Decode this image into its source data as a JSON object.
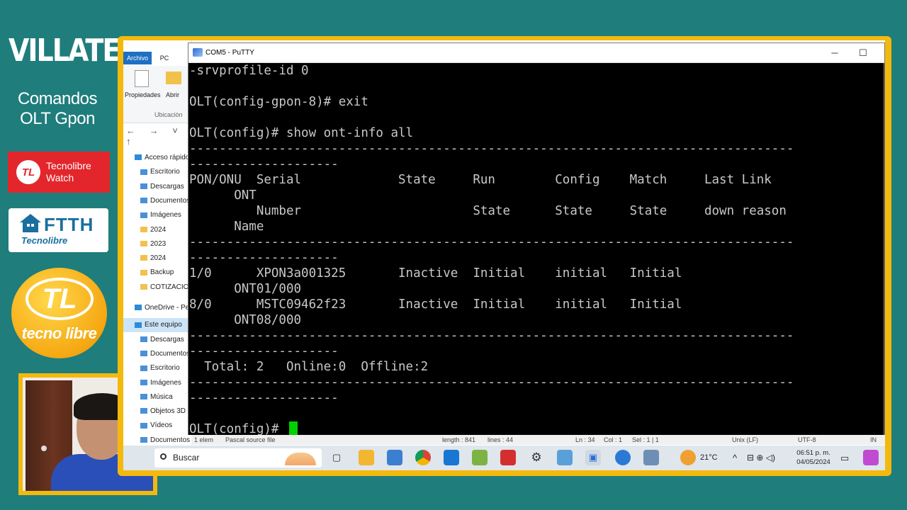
{
  "brand": {
    "name": "VILLATEL",
    "subtitle_line1": "Comandos",
    "subtitle_line2": "OLT Gpon",
    "badge1_mark": "TL",
    "badge1_line1": "Tecnolibre",
    "badge1_line2": "Watch",
    "badge2_main": "FTTH",
    "badge2_sub": "Tecnolibre",
    "logo_mark": "TL",
    "logo_text": "tecno libre"
  },
  "explorer": {
    "tab_file": "Archivo",
    "tab_pc": "PC",
    "ribbon_properties": "Propiedades",
    "ribbon_open": "Abrir",
    "ribbon_group": "Ubicación",
    "nav_arrows": "← → ˅ ↑",
    "items": [
      {
        "label": "Acceso rápido",
        "top": true
      },
      {
        "label": "Escritorio"
      },
      {
        "label": "Descargas"
      },
      {
        "label": "Documentos"
      },
      {
        "label": "Imágenes"
      },
      {
        "label": "2024"
      },
      {
        "label": "2023"
      },
      {
        "label": "2024"
      },
      {
        "label": "Backup"
      },
      {
        "label": "COTIZACIONES"
      },
      {
        "label": "OneDrive - Personal",
        "top": true
      },
      {
        "label": "Este equipo",
        "top": true,
        "selected": true
      },
      {
        "label": "Descargas"
      },
      {
        "label": "Documentos"
      },
      {
        "label": "Escritorio"
      },
      {
        "label": "Imágenes"
      },
      {
        "label": "Música"
      },
      {
        "label": "Objetos 3D"
      },
      {
        "label": "Vídeos"
      },
      {
        "label": "Documentos"
      }
    ],
    "status": "1 elem"
  },
  "editor_status": {
    "filetype": "Pascal source file",
    "length": "length : 841",
    "lines": "lines : 44",
    "ln": "Ln : 34",
    "col": "Col : 1",
    "sel": "Sel : 1 | 1",
    "eol": "Unix (LF)",
    "encoding": "UTF-8",
    "mode": "IN"
  },
  "putty": {
    "title": "COM5 - PuTTY",
    "minimize": "─",
    "maximize": "☐",
    "lines": [
      "-srvprofile-id 0",
      "",
      "OLT(config-gpon-8)# exit",
      "",
      "OLT(config)# show ont-info all",
      "---------------------------------------------------------------------------------",
      "--------------------",
      "PON/ONU  Serial             State     Run        Config    Match     Last Link",
      "      ONT",
      "         Number                       State      State     State     down reason",
      "      Name",
      "---------------------------------------------------------------------------------",
      "--------------------",
      "1/0      XPON3a001325       Inactive  Initial    initial   Initial",
      "      ONT01/000",
      "8/0      MSTC09462f23       Inactive  Initial    initial   Initial",
      "      ONT08/000",
      "---------------------------------------------------------------------------------",
      "--------------------",
      "  Total: 2   Online:0  Offline:2",
      "---------------------------------------------------------------------------------",
      "--------------------",
      "",
      "OLT(config)# "
    ]
  },
  "taskbar": {
    "search_placeholder": "Buscar",
    "weather": "21°C",
    "time": "06:51 p. m.",
    "date": "04/05/2024",
    "colors": {
      "accent_frame": "#f4b90d",
      "background": "#1f7d7c",
      "cursor": "#00d000"
    }
  }
}
